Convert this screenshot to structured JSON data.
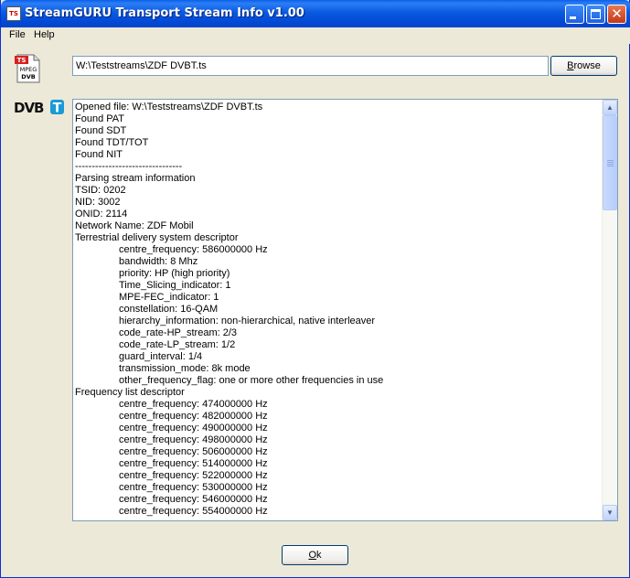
{
  "window": {
    "title": "StreamGURU Transport Stream Info v1.00",
    "icon_label": "TS"
  },
  "menu": {
    "file_label": "File",
    "help_label": "Help"
  },
  "file_icon": {
    "badge": "TS",
    "line1": "MPEG",
    "line2": "DVB"
  },
  "path": {
    "value": "W:\\Teststreams\\ZDF DVBT.ts"
  },
  "buttons": {
    "browse": "Browse",
    "ok": "Ok"
  },
  "logo": {
    "text": "DVB",
    "letter": "T"
  },
  "log": {
    "lines": [
      {
        "text": "Opened file: W:\\Teststreams\\ZDF DVBT.ts",
        "indent": false
      },
      {
        "text": "Found PAT",
        "indent": false
      },
      {
        "text": "Found SDT",
        "indent": false
      },
      {
        "text": "Found TDT/TOT",
        "indent": false
      },
      {
        "text": "Found NIT",
        "indent": false
      },
      {
        "text": "--------------------------------",
        "indent": false
      },
      {
        "text": "Parsing stream information",
        "indent": false
      },
      {
        "text": "TSID: 0202",
        "indent": false
      },
      {
        "text": "NID: 3002",
        "indent": false
      },
      {
        "text": "ONID: 2114",
        "indent": false
      },
      {
        "text": "Network Name: ZDF Mobil",
        "indent": false
      },
      {
        "text": "Terrestrial delivery system descriptor",
        "indent": false
      },
      {
        "text": "centre_frequency: 586000000 Hz",
        "indent": true
      },
      {
        "text": "bandwidth: 8 Mhz",
        "indent": true
      },
      {
        "text": "priority: HP (high priority)",
        "indent": true
      },
      {
        "text": "Time_Slicing_indicator: 1",
        "indent": true
      },
      {
        "text": "MPE-FEC_indicator: 1",
        "indent": true
      },
      {
        "text": "constellation: 16-QAM",
        "indent": true
      },
      {
        "text": "hierarchy_information: non-hierarchical, native interleaver",
        "indent": true
      },
      {
        "text": "code_rate-HP_stream: 2/3",
        "indent": true
      },
      {
        "text": "code_rate-LP_stream: 1/2",
        "indent": true
      },
      {
        "text": "guard_interval: 1/4",
        "indent": true
      },
      {
        "text": "transmission_mode: 8k mode",
        "indent": true
      },
      {
        "text": "other_frequency_flag: one or more other frequencies in use",
        "indent": true
      },
      {
        "text": "Frequency list descriptor",
        "indent": false
      },
      {
        "text": "centre_frequency: 474000000 Hz",
        "indent": true
      },
      {
        "text": "centre_frequency: 482000000 Hz",
        "indent": true
      },
      {
        "text": "centre_frequency: 490000000 Hz",
        "indent": true
      },
      {
        "text": "centre_frequency: 498000000 Hz",
        "indent": true
      },
      {
        "text": "centre_frequency: 506000000 Hz",
        "indent": true
      },
      {
        "text": "centre_frequency: 514000000 Hz",
        "indent": true
      },
      {
        "text": "centre_frequency: 522000000 Hz",
        "indent": true
      },
      {
        "text": "centre_frequency: 530000000 Hz",
        "indent": true
      },
      {
        "text": "centre_frequency: 546000000 Hz",
        "indent": true
      },
      {
        "text": "centre_frequency: 554000000 Hz",
        "indent": true
      }
    ]
  }
}
